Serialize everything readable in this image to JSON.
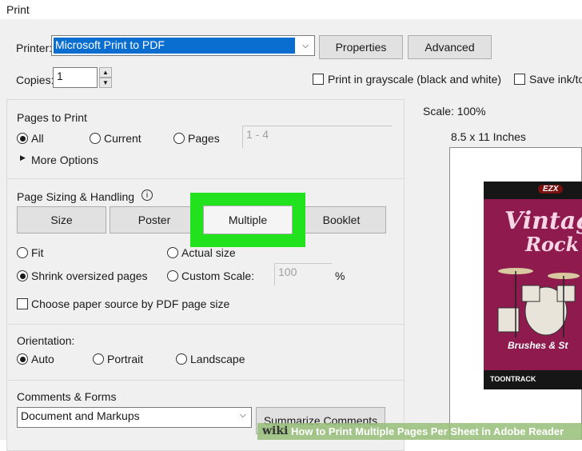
{
  "window": {
    "title": "Print"
  },
  "printer": {
    "label": "Printer:",
    "value": "Microsoft Print to PDF",
    "properties": "Properties",
    "advanced": "Advanced"
  },
  "copies": {
    "label": "Copies:",
    "value": "1"
  },
  "options": {
    "grayscale": "Print in grayscale (black and white)",
    "save_ink": "Save ink/to"
  },
  "pages_to_print": {
    "heading": "Pages to Print",
    "all": "All",
    "current": "Current",
    "pages": "Pages",
    "pages_range": "1 - 4",
    "more_options": "More Options"
  },
  "sizing": {
    "heading": "Page Sizing & Handling",
    "tabs": [
      "Size",
      "Poster",
      "Multiple",
      "Booklet"
    ],
    "fit": "Fit",
    "actual_size": "Actual size",
    "shrink": "Shrink oversized pages",
    "custom_scale": "Custom Scale:",
    "custom_scale_value": "100",
    "percent": "%",
    "paper_source": "Choose paper source by PDF page size"
  },
  "orientation": {
    "heading": "Orientation:",
    "auto": "Auto",
    "portrait": "Portrait",
    "landscape": "Landscape"
  },
  "comments": {
    "heading": "Comments & Forms",
    "value": "Document and Markups",
    "summarize": "Summarize Comments"
  },
  "preview": {
    "scale": "Scale: 100%",
    "size": "8.5 x 11 Inches",
    "image_title_1": "Vintage",
    "image_title_2": "Rock",
    "image_sub": "Brushes & St",
    "brand": "TOONTRACK",
    "badge": "EZX"
  },
  "watermark": {
    "wiki": "wiki",
    "text": "How to Print Multiple Pages Per Sheet in Adobe Reader"
  },
  "colors": {
    "highlight": "#22e21e",
    "selection": "#0a6ed1",
    "poster_bg": "#8e1a4e"
  }
}
